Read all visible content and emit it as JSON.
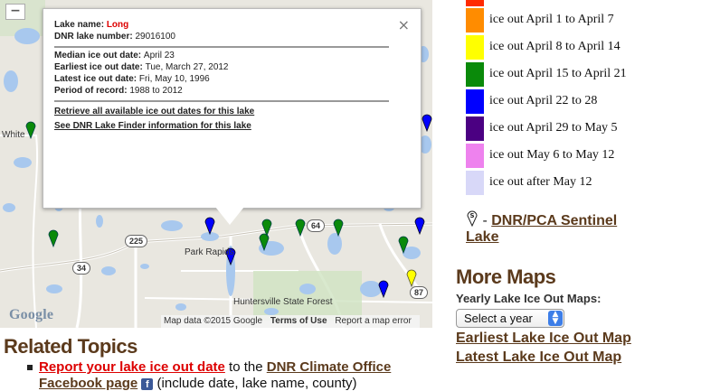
{
  "map": {
    "zoom_out": "−",
    "place_labels": {
      "white": "White",
      "park_rapids": "Park Rapids",
      "forest": "Huntersville State Forest"
    },
    "road_shields": {
      "r225": "225",
      "r34": "34",
      "r64": "64",
      "r87": "87"
    },
    "logo": "Google",
    "attribution": {
      "data": "Map data ©2015 Google",
      "terms": "Terms of Use",
      "report": "Report a map error"
    },
    "info": {
      "close": "×",
      "lake_name_label": "Lake name: ",
      "lake_name": "Long",
      "dnr_label": "DNR lake number: ",
      "dnr_number": "29016100",
      "median_label": "Median ice out date: ",
      "median": "April 23",
      "earliest_label": "Earliest ice out date: ",
      "earliest": "Tue, March 27, 2012",
      "latest_label": "Latest ice out date: ",
      "latest": "Fri, May 10, 1996",
      "period_label": "Period of record: ",
      "period": "1988 to 2012",
      "link_all": "Retrieve all available ice out dates for this lake",
      "link_finder": "See DNR Lake Finder information for this lake"
    }
  },
  "related": {
    "heading": "Related Topics",
    "report_link": "Report your lake ice out date",
    "to_the": " to the ",
    "climate_link": "DNR Climate Office",
    "facebook_link": "Facebook page",
    "fb_icon": "f",
    "include_text": " (include date, lake name, county)"
  },
  "legend": {
    "items": [
      {
        "label": "ice out April 1 to April 7",
        "color": "#ff8c00"
      },
      {
        "label": "ice out April 8 to April 14",
        "color": "#ffff00"
      },
      {
        "label": "ice out April 15 to April 21",
        "color": "#0a8a0a"
      },
      {
        "label": "ice out April 22 to 28",
        "color": "#0000ff"
      },
      {
        "label": "ice out April 29 to May 5",
        "color": "#4b0082"
      },
      {
        "label": "ice out May 6 to May 12",
        "color": "#ee82ee"
      },
      {
        "label": "ice out after May 12",
        "color": "#d8d8f8"
      }
    ],
    "sentinel_dash": " - ",
    "sentinel_link": "DNR/PCA Sentinel",
    "sentinel_link2": "Lake"
  },
  "more_maps": {
    "heading": "More Maps",
    "yearly_label": "Yearly Lake Ice Out Maps:",
    "select_value": "Select a year",
    "earliest_link": "Earliest Lake Ice Out Map",
    "latest_link": "Latest Lake Ice Out Map"
  }
}
